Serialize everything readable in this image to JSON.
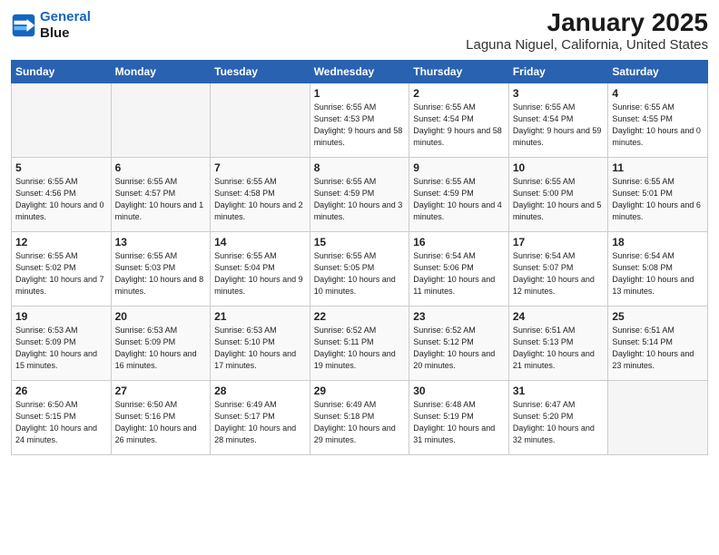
{
  "header": {
    "logo_line1": "General",
    "logo_line2": "Blue",
    "title": "January 2025",
    "subtitle": "Laguna Niguel, California, United States"
  },
  "calendar": {
    "days_of_week": [
      "Sunday",
      "Monday",
      "Tuesday",
      "Wednesday",
      "Thursday",
      "Friday",
      "Saturday"
    ],
    "weeks": [
      [
        {
          "day": "",
          "info": ""
        },
        {
          "day": "",
          "info": ""
        },
        {
          "day": "",
          "info": ""
        },
        {
          "day": "1",
          "info": "Sunrise: 6:55 AM\nSunset: 4:53 PM\nDaylight: 9 hours\nand 58 minutes."
        },
        {
          "day": "2",
          "info": "Sunrise: 6:55 AM\nSunset: 4:54 PM\nDaylight: 9 hours\nand 58 minutes."
        },
        {
          "day": "3",
          "info": "Sunrise: 6:55 AM\nSunset: 4:54 PM\nDaylight: 9 hours\nand 59 minutes."
        },
        {
          "day": "4",
          "info": "Sunrise: 6:55 AM\nSunset: 4:55 PM\nDaylight: 10 hours\nand 0 minutes."
        }
      ],
      [
        {
          "day": "5",
          "info": "Sunrise: 6:55 AM\nSunset: 4:56 PM\nDaylight: 10 hours\nand 0 minutes."
        },
        {
          "day": "6",
          "info": "Sunrise: 6:55 AM\nSunset: 4:57 PM\nDaylight: 10 hours\nand 1 minute."
        },
        {
          "day": "7",
          "info": "Sunrise: 6:55 AM\nSunset: 4:58 PM\nDaylight: 10 hours\nand 2 minutes."
        },
        {
          "day": "8",
          "info": "Sunrise: 6:55 AM\nSunset: 4:59 PM\nDaylight: 10 hours\nand 3 minutes."
        },
        {
          "day": "9",
          "info": "Sunrise: 6:55 AM\nSunset: 4:59 PM\nDaylight: 10 hours\nand 4 minutes."
        },
        {
          "day": "10",
          "info": "Sunrise: 6:55 AM\nSunset: 5:00 PM\nDaylight: 10 hours\nand 5 minutes."
        },
        {
          "day": "11",
          "info": "Sunrise: 6:55 AM\nSunset: 5:01 PM\nDaylight: 10 hours\nand 6 minutes."
        }
      ],
      [
        {
          "day": "12",
          "info": "Sunrise: 6:55 AM\nSunset: 5:02 PM\nDaylight: 10 hours\nand 7 minutes."
        },
        {
          "day": "13",
          "info": "Sunrise: 6:55 AM\nSunset: 5:03 PM\nDaylight: 10 hours\nand 8 minutes."
        },
        {
          "day": "14",
          "info": "Sunrise: 6:55 AM\nSunset: 5:04 PM\nDaylight: 10 hours\nand 9 minutes."
        },
        {
          "day": "15",
          "info": "Sunrise: 6:55 AM\nSunset: 5:05 PM\nDaylight: 10 hours\nand 10 minutes."
        },
        {
          "day": "16",
          "info": "Sunrise: 6:54 AM\nSunset: 5:06 PM\nDaylight: 10 hours\nand 11 minutes."
        },
        {
          "day": "17",
          "info": "Sunrise: 6:54 AM\nSunset: 5:07 PM\nDaylight: 10 hours\nand 12 minutes."
        },
        {
          "day": "18",
          "info": "Sunrise: 6:54 AM\nSunset: 5:08 PM\nDaylight: 10 hours\nand 13 minutes."
        }
      ],
      [
        {
          "day": "19",
          "info": "Sunrise: 6:53 AM\nSunset: 5:09 PM\nDaylight: 10 hours\nand 15 minutes."
        },
        {
          "day": "20",
          "info": "Sunrise: 6:53 AM\nSunset: 5:09 PM\nDaylight: 10 hours\nand 16 minutes."
        },
        {
          "day": "21",
          "info": "Sunrise: 6:53 AM\nSunset: 5:10 PM\nDaylight: 10 hours\nand 17 minutes."
        },
        {
          "day": "22",
          "info": "Sunrise: 6:52 AM\nSunset: 5:11 PM\nDaylight: 10 hours\nand 19 minutes."
        },
        {
          "day": "23",
          "info": "Sunrise: 6:52 AM\nSunset: 5:12 PM\nDaylight: 10 hours\nand 20 minutes."
        },
        {
          "day": "24",
          "info": "Sunrise: 6:51 AM\nSunset: 5:13 PM\nDaylight: 10 hours\nand 21 minutes."
        },
        {
          "day": "25",
          "info": "Sunrise: 6:51 AM\nSunset: 5:14 PM\nDaylight: 10 hours\nand 23 minutes."
        }
      ],
      [
        {
          "day": "26",
          "info": "Sunrise: 6:50 AM\nSunset: 5:15 PM\nDaylight: 10 hours\nand 24 minutes."
        },
        {
          "day": "27",
          "info": "Sunrise: 6:50 AM\nSunset: 5:16 PM\nDaylight: 10 hours\nand 26 minutes."
        },
        {
          "day": "28",
          "info": "Sunrise: 6:49 AM\nSunset: 5:17 PM\nDaylight: 10 hours\nand 28 minutes."
        },
        {
          "day": "29",
          "info": "Sunrise: 6:49 AM\nSunset: 5:18 PM\nDaylight: 10 hours\nand 29 minutes."
        },
        {
          "day": "30",
          "info": "Sunrise: 6:48 AM\nSunset: 5:19 PM\nDaylight: 10 hours\nand 31 minutes."
        },
        {
          "day": "31",
          "info": "Sunrise: 6:47 AM\nSunset: 5:20 PM\nDaylight: 10 hours\nand 32 minutes."
        },
        {
          "day": "",
          "info": ""
        }
      ]
    ]
  }
}
